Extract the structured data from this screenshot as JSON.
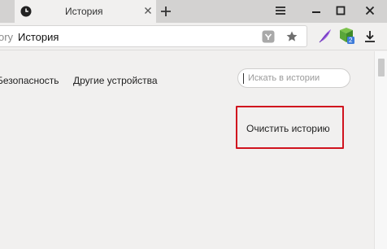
{
  "tab": {
    "title": "История",
    "favicon": "clock-icon",
    "close_icon": "close-icon"
  },
  "window_controls": {
    "menu_icon": "hamburger-icon",
    "minimize_icon": "minimize-icon",
    "maximize_icon": "maximize-icon",
    "close_icon": "close-window-icon",
    "new_tab_icon": "plus-icon"
  },
  "omnibox": {
    "host": "ory",
    "page_title": "История",
    "protect_icon": "protect-icon",
    "bookmark_icon": "star-icon"
  },
  "extensions": [
    {
      "icon": "feather-icon"
    },
    {
      "icon": "gift-icon",
      "badge": "2"
    }
  ],
  "download_icon": "download-icon",
  "nav": {
    "security": "Безопасность",
    "other_devices": "Другие устройства"
  },
  "search": {
    "placeholder": "Искать в истории"
  },
  "clear_history": "Очистить историю",
  "colors": {
    "tabstrip": "#d3d2d1",
    "background": "#f1f0ef",
    "highlight": "#d0131e",
    "feather": "#9b5fe0",
    "gift": "#5aa63a",
    "badge": "#3d7bd9"
  }
}
